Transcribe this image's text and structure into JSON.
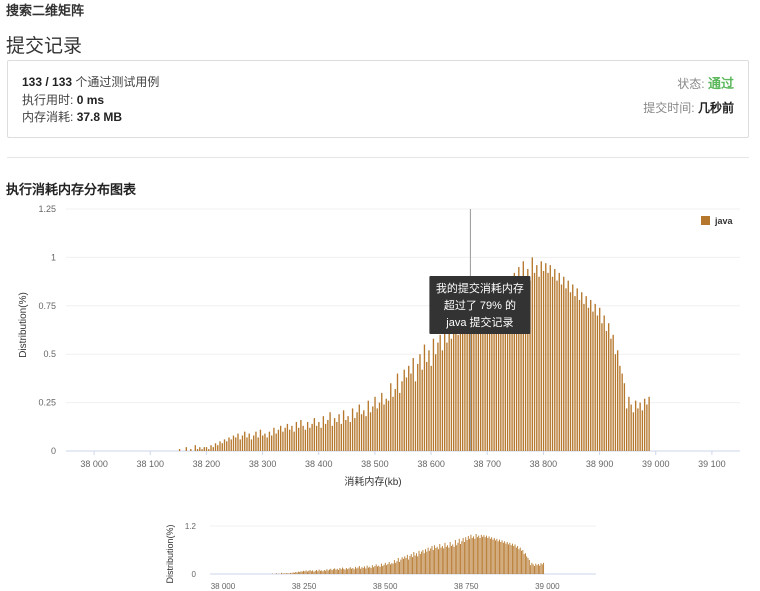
{
  "problem_title": "搜索二维矩阵",
  "page_title": "提交记录",
  "submission": {
    "passed": "133 / 133",
    "passed_suffix": "个通过测试用例",
    "runtime_label": "执行用时:",
    "runtime_value": "0 ms",
    "memory_label": "内存消耗:",
    "memory_value": "37.8 MB",
    "status_label": "状态:",
    "status_value": "通过",
    "time_label": "提交时间:",
    "time_value": "几秒前"
  },
  "colors": {
    "bar": "#b5772c",
    "status": "#5cb85c",
    "tooltip_bg": "#333333"
  },
  "section_title": "执行消耗内存分布图表",
  "tooltip": {
    "line1": "我的提交消耗内存",
    "line2": "超过了 79% 的",
    "line3": "java 提交记录"
  },
  "chart_data": [
    {
      "type": "bar",
      "xlabel": "消耗内存(kb)",
      "ylabel": "Distribution(%)",
      "xlim": [
        37950,
        39150
      ],
      "ylim": [
        0,
        1.25
      ],
      "y_ticks": [
        "0",
        "0.25",
        "0.5",
        "0.75",
        "1",
        "1.25"
      ],
      "x_ticks": [
        "38 000",
        "38 100",
        "38 200",
        "38 300",
        "38 400",
        "38 500",
        "38 600",
        "38 700",
        "38 800",
        "38 900",
        "39 000",
        "39 100"
      ],
      "legend": "java",
      "my_submission_kb": 38670,
      "series": [
        {
          "name": "java",
          "x_start": 37955,
          "x_step": 4,
          "values": [
            0,
            0,
            0,
            0,
            0,
            0,
            0,
            0,
            0,
            0,
            0,
            0,
            0,
            0,
            0,
            0,
            0,
            0,
            0,
            0,
            0,
            0,
            0,
            0,
            0,
            0,
            0,
            0,
            0,
            0,
            0,
            0,
            0,
            0,
            0,
            0,
            0,
            0,
            0,
            0,
            0,
            0,
            0,
            0,
            0,
            0,
            0,
            0,
            0,
            0.01,
            0,
            0,
            0.02,
            0,
            0.01,
            0,
            0.03,
            0.01,
            0.02,
            0.01,
            0.02,
            0.02,
            0.01,
            0.03,
            0.02,
            0.04,
            0.03,
            0.05,
            0.04,
            0.06,
            0.05,
            0.07,
            0.06,
            0.08,
            0.07,
            0.09,
            0.06,
            0.08,
            0.1,
            0.07,
            0.09,
            0.06,
            0.08,
            0.1,
            0.07,
            0.11,
            0.08,
            0.09,
            0.07,
            0.1,
            0.08,
            0.12,
            0.09,
            0.11,
            0.13,
            0.1,
            0.12,
            0.14,
            0.11,
            0.13,
            0.1,
            0.15,
            0.12,
            0.16,
            0.13,
            0.11,
            0.15,
            0.12,
            0.14,
            0.17,
            0.13,
            0.15,
            0.12,
            0.18,
            0.14,
            0.16,
            0.2,
            0.13,
            0.17,
            0.15,
            0.19,
            0.14,
            0.21,
            0.16,
            0.18,
            0.15,
            0.22,
            0.17,
            0.2,
            0.24,
            0.19,
            0.21,
            0.18,
            0.26,
            0.2,
            0.23,
            0.28,
            0.22,
            0.25,
            0.3,
            0.24,
            0.27,
            0.26,
            0.35,
            0.28,
            0.32,
            0.4,
            0.3,
            0.36,
            0.42,
            0.38,
            0.44,
            0.4,
            0.48,
            0.36,
            0.45,
            0.5,
            0.42,
            0.55,
            0.46,
            0.52,
            0.44,
            0.58,
            0.5,
            0.56,
            0.6,
            0.52,
            0.62,
            0.56,
            0.66,
            0.58,
            0.64,
            0.7,
            0.6,
            0.72,
            0.65,
            0.68,
            0.62,
            0.75,
            0.66,
            0.7,
            0.64,
            0.78,
            0.68,
            0.72,
            0.66,
            0.8,
            0.7,
            0.74,
            0.68,
            0.85,
            0.72,
            0.78,
            0.88,
            0.75,
            0.82,
            0.9,
            0.8,
            0.92,
            0.85,
            0.95,
            0.88,
            0.98,
            0.9,
            0.94,
            0.88,
            1.0,
            0.92,
            0.96,
            0.9,
            0.98,
            0.93,
            0.97,
            0.92,
            0.96,
            0.9,
            0.94,
            0.88,
            0.92,
            0.86,
            0.9,
            0.84,
            0.88,
            0.82,
            0.86,
            0.8,
            0.84,
            0.78,
            0.82,
            0.76,
            0.8,
            0.74,
            0.78,
            0.72,
            0.76,
            0.7,
            0.74,
            0.66,
            0.7,
            0.62,
            0.66,
            0.58,
            0.6,
            0.5,
            0.52,
            0.44,
            0.4,
            0.35,
            0.22,
            0.28,
            0.24,
            0.2,
            0.26,
            0.22,
            0.25,
            0.21,
            0.27,
            0.24,
            0.28
          ]
        }
      ]
    },
    {
      "type": "bar",
      "xlabel": "",
      "ylabel": "Distribution(%)",
      "xlim": [
        37960,
        39150
      ],
      "ylim": [
        0,
        1.2
      ],
      "y_ticks": [
        "1.2",
        "0"
      ],
      "x_ticks": [
        "38 000",
        "38 250",
        "38 500",
        "38 750",
        "39 000"
      ]
    }
  ]
}
